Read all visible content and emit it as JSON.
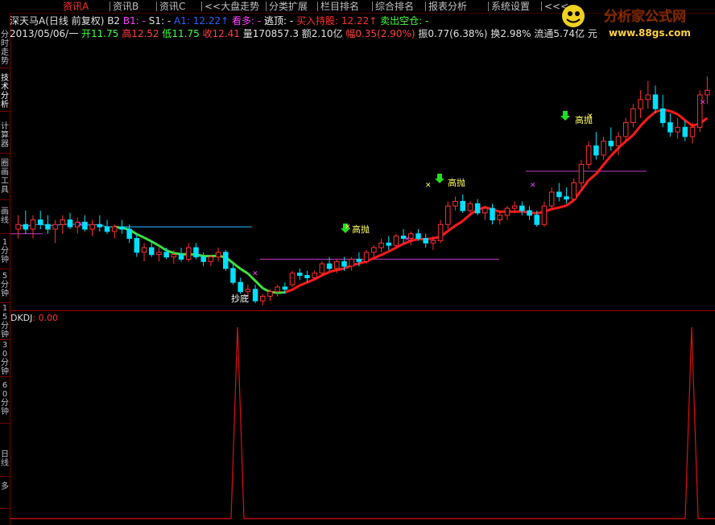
{
  "tabs": [
    {
      "label": "资讯A",
      "active": true
    },
    {
      "label": "资讯B",
      "active": false
    },
    {
      "label": "资讯C",
      "active": false
    },
    {
      "label": "<<大盘走势",
      "active": false
    },
    {
      "label": "分类扩展",
      "active": false
    },
    {
      "label": "栏目排名",
      "active": false
    },
    {
      "label": "综合排名",
      "active": false
    },
    {
      "label": "报表分析",
      "active": false
    },
    {
      "label": "系统设置",
      "active": false
    },
    {
      "label": "<<<",
      "active": false
    }
  ],
  "sidebar": [
    {
      "label": "分时走势"
    },
    {
      "label": "技术分析",
      "active": true
    },
    {
      "label": "计算器"
    },
    {
      "label": "圈画工具"
    },
    {
      "label": "画线"
    },
    {
      "label": "1分钟"
    },
    {
      "label": "5分钟"
    },
    {
      "label": "15分钟"
    },
    {
      "label": "30分钟"
    },
    {
      "label": "60分钟"
    },
    {
      "label": "日线"
    },
    {
      "label": "多"
    }
  ],
  "header": {
    "line1": [
      {
        "text": "深天马A(日线 前复权) B2 ",
        "color": "#e0e0e0"
      },
      {
        "text": "B1: - ",
        "color": "#ff40ff"
      },
      {
        "text": "S1: - ",
        "color": "#e0e0e0"
      },
      {
        "text": "A1: 12.22↑ ",
        "color": "#3060ff"
      },
      {
        "text": "看多: - ",
        "color": "#ff40ff"
      },
      {
        "text": "逃顶: - ",
        "color": "#ffffff"
      },
      {
        "text": "买入持股: 12.22↑ ",
        "color": "#ff3030"
      },
      {
        "text": "卖出空仓: -",
        "color": "#40ff40"
      }
    ],
    "line2": [
      {
        "text": "2013/05/06/一 ",
        "color": "#e0e0e0"
      },
      {
        "text": "开11.75 ",
        "color": "#40ff40"
      },
      {
        "text": "高12.52 ",
        "color": "#ff4040"
      },
      {
        "text": "低11.75 ",
        "color": "#40ff40"
      },
      {
        "text": "收12.41 ",
        "color": "#ff4040"
      },
      {
        "text": "量170857.3 ",
        "color": "#e0e0e0"
      },
      {
        "text": "额2.10亿 ",
        "color": "#e0e0e0"
      },
      {
        "text": "幅0.35(2.90%) ",
        "color": "#ff4040"
      },
      {
        "text": "振0.77(6.38%) ",
        "color": "#e0e0e0"
      },
      {
        "text": "换2.98% ",
        "color": "#e0e0e0"
      },
      {
        "text": "流通5.74亿 元",
        "color": "#e0e0e0"
      }
    ]
  },
  "logo": {
    "title": "分析家公式网",
    "url": "www.88gs.com"
  },
  "annotations": {
    "sell1": "高抛",
    "sell2": "高抛",
    "sell3": "高抛",
    "bottom": "抄底"
  },
  "indicator": {
    "name": "DKDJ",
    "value": ": 0.00"
  },
  "colors": {
    "up": "#ff3030",
    "down": "#00e0ff",
    "ma_up": "#ff1a1a",
    "ma_down": "#40e040",
    "indicator": "#e01010",
    "border": "#a00000"
  },
  "chart_data": {
    "type": "candlestick",
    "series": [
      {
        "o": 11.0,
        "h": 11.3,
        "l": 10.8,
        "c": 11.1
      },
      {
        "o": 11.1,
        "h": 11.4,
        "l": 10.9,
        "c": 11.0
      },
      {
        "o": 11.0,
        "h": 11.3,
        "l": 10.8,
        "c": 11.2
      },
      {
        "o": 11.2,
        "h": 11.4,
        "l": 11.0,
        "c": 11.1
      },
      {
        "o": 11.1,
        "h": 11.3,
        "l": 10.9,
        "c": 11.0
      },
      {
        "o": 11.0,
        "h": 11.2,
        "l": 10.7,
        "c": 11.1
      },
      {
        "o": 11.1,
        "h": 11.3,
        "l": 10.9,
        "c": 11.2
      },
      {
        "o": 11.2,
        "h": 11.35,
        "l": 11.0,
        "c": 11.05
      },
      {
        "o": 11.05,
        "h": 11.25,
        "l": 10.9,
        "c": 11.15
      },
      {
        "o": 11.15,
        "h": 11.3,
        "l": 10.95,
        "c": 11.0
      },
      {
        "o": 11.0,
        "h": 11.2,
        "l": 10.85,
        "c": 11.1
      },
      {
        "o": 11.1,
        "h": 11.3,
        "l": 10.95,
        "c": 11.05
      },
      {
        "o": 11.05,
        "h": 11.2,
        "l": 10.9,
        "c": 10.95
      },
      {
        "o": 10.95,
        "h": 11.1,
        "l": 10.8,
        "c": 11.05
      },
      {
        "o": 11.05,
        "h": 11.2,
        "l": 10.9,
        "c": 11.0
      },
      {
        "o": 11.0,
        "h": 11.1,
        "l": 10.7,
        "c": 10.8
      },
      {
        "o": 10.8,
        "h": 10.9,
        "l": 10.4,
        "c": 10.5
      },
      {
        "o": 10.5,
        "h": 10.7,
        "l": 10.3,
        "c": 10.6
      },
      {
        "o": 10.6,
        "h": 10.75,
        "l": 10.4,
        "c": 10.45
      },
      {
        "o": 10.45,
        "h": 10.6,
        "l": 10.3,
        "c": 10.5
      },
      {
        "o": 10.5,
        "h": 10.6,
        "l": 10.35,
        "c": 10.4
      },
      {
        "o": 10.4,
        "h": 10.55,
        "l": 10.25,
        "c": 10.45
      },
      {
        "o": 10.45,
        "h": 10.6,
        "l": 10.3,
        "c": 10.35
      },
      {
        "o": 10.35,
        "h": 10.7,
        "l": 10.3,
        "c": 10.6
      },
      {
        "o": 10.6,
        "h": 10.7,
        "l": 10.35,
        "c": 10.4
      },
      {
        "o": 10.4,
        "h": 10.5,
        "l": 10.2,
        "c": 10.3
      },
      {
        "o": 10.3,
        "h": 10.45,
        "l": 10.2,
        "c": 10.4
      },
      {
        "o": 10.4,
        "h": 10.6,
        "l": 10.3,
        "c": 10.5
      },
      {
        "o": 10.5,
        "h": 10.55,
        "l": 10.1,
        "c": 10.15
      },
      {
        "o": 10.15,
        "h": 10.25,
        "l": 9.8,
        "c": 9.85
      },
      {
        "o": 9.85,
        "h": 9.95,
        "l": 9.6,
        "c": 9.65
      },
      {
        "o": 9.65,
        "h": 9.8,
        "l": 9.5,
        "c": 9.7
      },
      {
        "o": 9.7,
        "h": 9.8,
        "l": 9.4,
        "c": 9.45
      },
      {
        "o": 9.45,
        "h": 9.6,
        "l": 9.35,
        "c": 9.55
      },
      {
        "o": 9.55,
        "h": 9.7,
        "l": 9.45,
        "c": 9.65
      },
      {
        "o": 9.65,
        "h": 9.8,
        "l": 9.55,
        "c": 9.75
      },
      {
        "o": 9.75,
        "h": 9.85,
        "l": 9.6,
        "c": 9.7
      },
      {
        "o": 9.8,
        "h": 10.1,
        "l": 9.75,
        "c": 10.05
      },
      {
        "o": 10.05,
        "h": 10.15,
        "l": 9.9,
        "c": 10.0
      },
      {
        "o": 10.0,
        "h": 10.1,
        "l": 9.85,
        "c": 9.95
      },
      {
        "o": 9.95,
        "h": 10.1,
        "l": 9.9,
        "c": 10.05
      },
      {
        "o": 10.05,
        "h": 10.3,
        "l": 10.0,
        "c": 10.25
      },
      {
        "o": 10.25,
        "h": 10.4,
        "l": 10.1,
        "c": 10.15
      },
      {
        "o": 10.15,
        "h": 10.35,
        "l": 10.05,
        "c": 10.3
      },
      {
        "o": 10.3,
        "h": 10.4,
        "l": 10.1,
        "c": 10.2
      },
      {
        "o": 10.2,
        "h": 10.4,
        "l": 10.1,
        "c": 10.35
      },
      {
        "o": 10.35,
        "h": 10.5,
        "l": 10.2,
        "c": 10.3
      },
      {
        "o": 10.3,
        "h": 10.55,
        "l": 10.25,
        "c": 10.5
      },
      {
        "o": 10.5,
        "h": 10.65,
        "l": 10.4,
        "c": 10.6
      },
      {
        "o": 10.6,
        "h": 10.8,
        "l": 10.5,
        "c": 10.7
      },
      {
        "o": 10.7,
        "h": 10.85,
        "l": 10.55,
        "c": 10.65
      },
      {
        "o": 10.65,
        "h": 10.9,
        "l": 10.6,
        "c": 10.85
      },
      {
        "o": 10.85,
        "h": 11.0,
        "l": 10.7,
        "c": 10.8
      },
      {
        "o": 10.8,
        "h": 10.95,
        "l": 10.65,
        "c": 10.9
      },
      {
        "o": 10.9,
        "h": 11.0,
        "l": 10.75,
        "c": 10.8
      },
      {
        "o": 10.8,
        "h": 10.9,
        "l": 10.6,
        "c": 10.7
      },
      {
        "o": 10.7,
        "h": 10.85,
        "l": 10.55,
        "c": 10.75
      },
      {
        "o": 10.75,
        "h": 11.2,
        "l": 10.7,
        "c": 11.1
      },
      {
        "o": 11.1,
        "h": 11.6,
        "l": 11.0,
        "c": 11.5
      },
      {
        "o": 11.5,
        "h": 11.7,
        "l": 11.4,
        "c": 11.6
      },
      {
        "o": 11.6,
        "h": 11.75,
        "l": 11.35,
        "c": 11.4
      },
      {
        "o": 11.4,
        "h": 11.6,
        "l": 11.3,
        "c": 11.55
      },
      {
        "o": 11.55,
        "h": 11.65,
        "l": 11.3,
        "c": 11.35
      },
      {
        "o": 11.35,
        "h": 11.5,
        "l": 11.2,
        "c": 11.45
      },
      {
        "o": 11.45,
        "h": 11.55,
        "l": 11.1,
        "c": 11.2
      },
      {
        "o": 11.2,
        "h": 11.4,
        "l": 11.1,
        "c": 11.3
      },
      {
        "o": 11.3,
        "h": 11.5,
        "l": 11.2,
        "c": 11.45
      },
      {
        "o": 11.45,
        "h": 11.6,
        "l": 11.35,
        "c": 11.5
      },
      {
        "o": 11.5,
        "h": 11.6,
        "l": 11.3,
        "c": 11.4
      },
      {
        "o": 11.4,
        "h": 11.5,
        "l": 11.2,
        "c": 11.3
      },
      {
        "o": 11.3,
        "h": 11.4,
        "l": 11.05,
        "c": 11.1
      },
      {
        "o": 11.1,
        "h": 11.6,
        "l": 11.05,
        "c": 11.5
      },
      {
        "o": 11.5,
        "h": 11.9,
        "l": 11.45,
        "c": 11.8
      },
      {
        "o": 11.8,
        "h": 12.0,
        "l": 11.6,
        "c": 11.7
      },
      {
        "o": 11.7,
        "h": 11.9,
        "l": 11.55,
        "c": 11.65
      },
      {
        "o": 11.65,
        "h": 12.1,
        "l": 11.6,
        "c": 12.0
      },
      {
        "o": 12.0,
        "h": 12.5,
        "l": 11.9,
        "c": 12.4
      },
      {
        "o": 12.4,
        "h": 12.9,
        "l": 12.3,
        "c": 12.8
      },
      {
        "o": 12.8,
        "h": 13.1,
        "l": 12.5,
        "c": 12.6
      },
      {
        "o": 12.6,
        "h": 13.0,
        "l": 12.5,
        "c": 12.9
      },
      {
        "o": 12.9,
        "h": 13.2,
        "l": 12.7,
        "c": 12.8
      },
      {
        "o": 12.8,
        "h": 13.1,
        "l": 12.6,
        "c": 13.0
      },
      {
        "o": 13.0,
        "h": 13.4,
        "l": 12.9,
        "c": 13.3
      },
      {
        "o": 13.3,
        "h": 13.7,
        "l": 13.2,
        "c": 13.6
      },
      {
        "o": 13.6,
        "h": 14.0,
        "l": 13.4,
        "c": 13.8
      },
      {
        "o": 13.8,
        "h": 14.2,
        "l": 13.6,
        "c": 13.9
      },
      {
        "o": 13.9,
        "h": 14.1,
        "l": 13.5,
        "c": 13.6
      },
      {
        "o": 13.6,
        "h": 13.9,
        "l": 13.2,
        "c": 13.3
      },
      {
        "o": 13.3,
        "h": 13.5,
        "l": 13.0,
        "c": 13.1
      },
      {
        "o": 13.1,
        "h": 13.4,
        "l": 12.95,
        "c": 13.2
      },
      {
        "o": 13.2,
        "h": 13.35,
        "l": 12.9,
        "c": 13.0
      },
      {
        "o": 13.0,
        "h": 13.3,
        "l": 12.85,
        "c": 13.2
      },
      {
        "o": 13.2,
        "h": 14.0,
        "l": 13.1,
        "c": 13.9
      },
      {
        "o": 13.9,
        "h": 14.3,
        "l": 13.7,
        "c": 14.0
      }
    ]
  }
}
